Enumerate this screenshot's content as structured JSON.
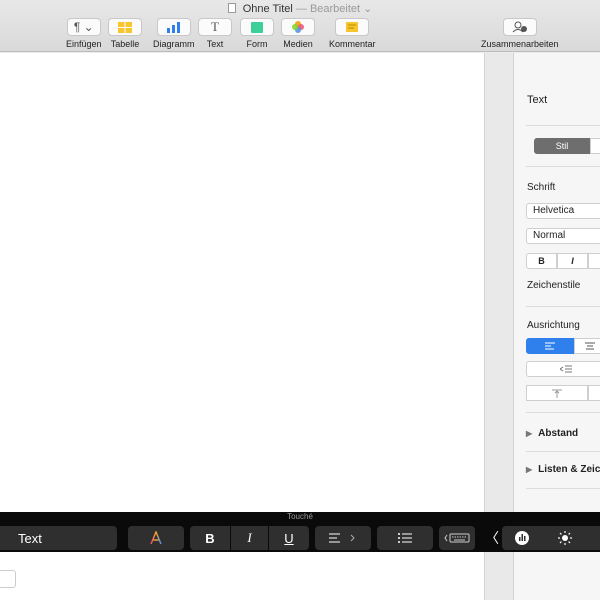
{
  "window": {
    "title": "Ohne Titel",
    "status": "— Bearbeitet",
    "status_chevron": "⌄"
  },
  "toolbar": {
    "insert": {
      "label": "Einfügen",
      "glyph": "¶ ⌄"
    },
    "table": {
      "label": "Tabelle"
    },
    "chart": {
      "label": "Diagramm"
    },
    "text": {
      "label": "Text",
      "glyph": "T"
    },
    "shape": {
      "label": "Form"
    },
    "media": {
      "label": "Medien"
    },
    "comment": {
      "label": "Kommentar"
    },
    "collaborate": {
      "label": "Zusammenarbeiten"
    }
  },
  "inspector": {
    "tab_text": "Text",
    "style_tab": "Stil",
    "font_section": "Schrift",
    "font_family": "Helvetica",
    "font_weight": "Normal",
    "bold": "B",
    "italic": "I",
    "char_styles": "Zeichenstile",
    "alignment": "Ausrichtung",
    "spacing": "Abstand",
    "lists": "Listen & Zeich"
  },
  "touchbar": {
    "title": "Touché",
    "text_key": "Text",
    "bold": "B",
    "italic": "I",
    "underline": "U",
    "chevron_left": "〈"
  },
  "colors": {
    "accent": "#2f80ed",
    "touchbar_key": "#2f2f2f"
  }
}
